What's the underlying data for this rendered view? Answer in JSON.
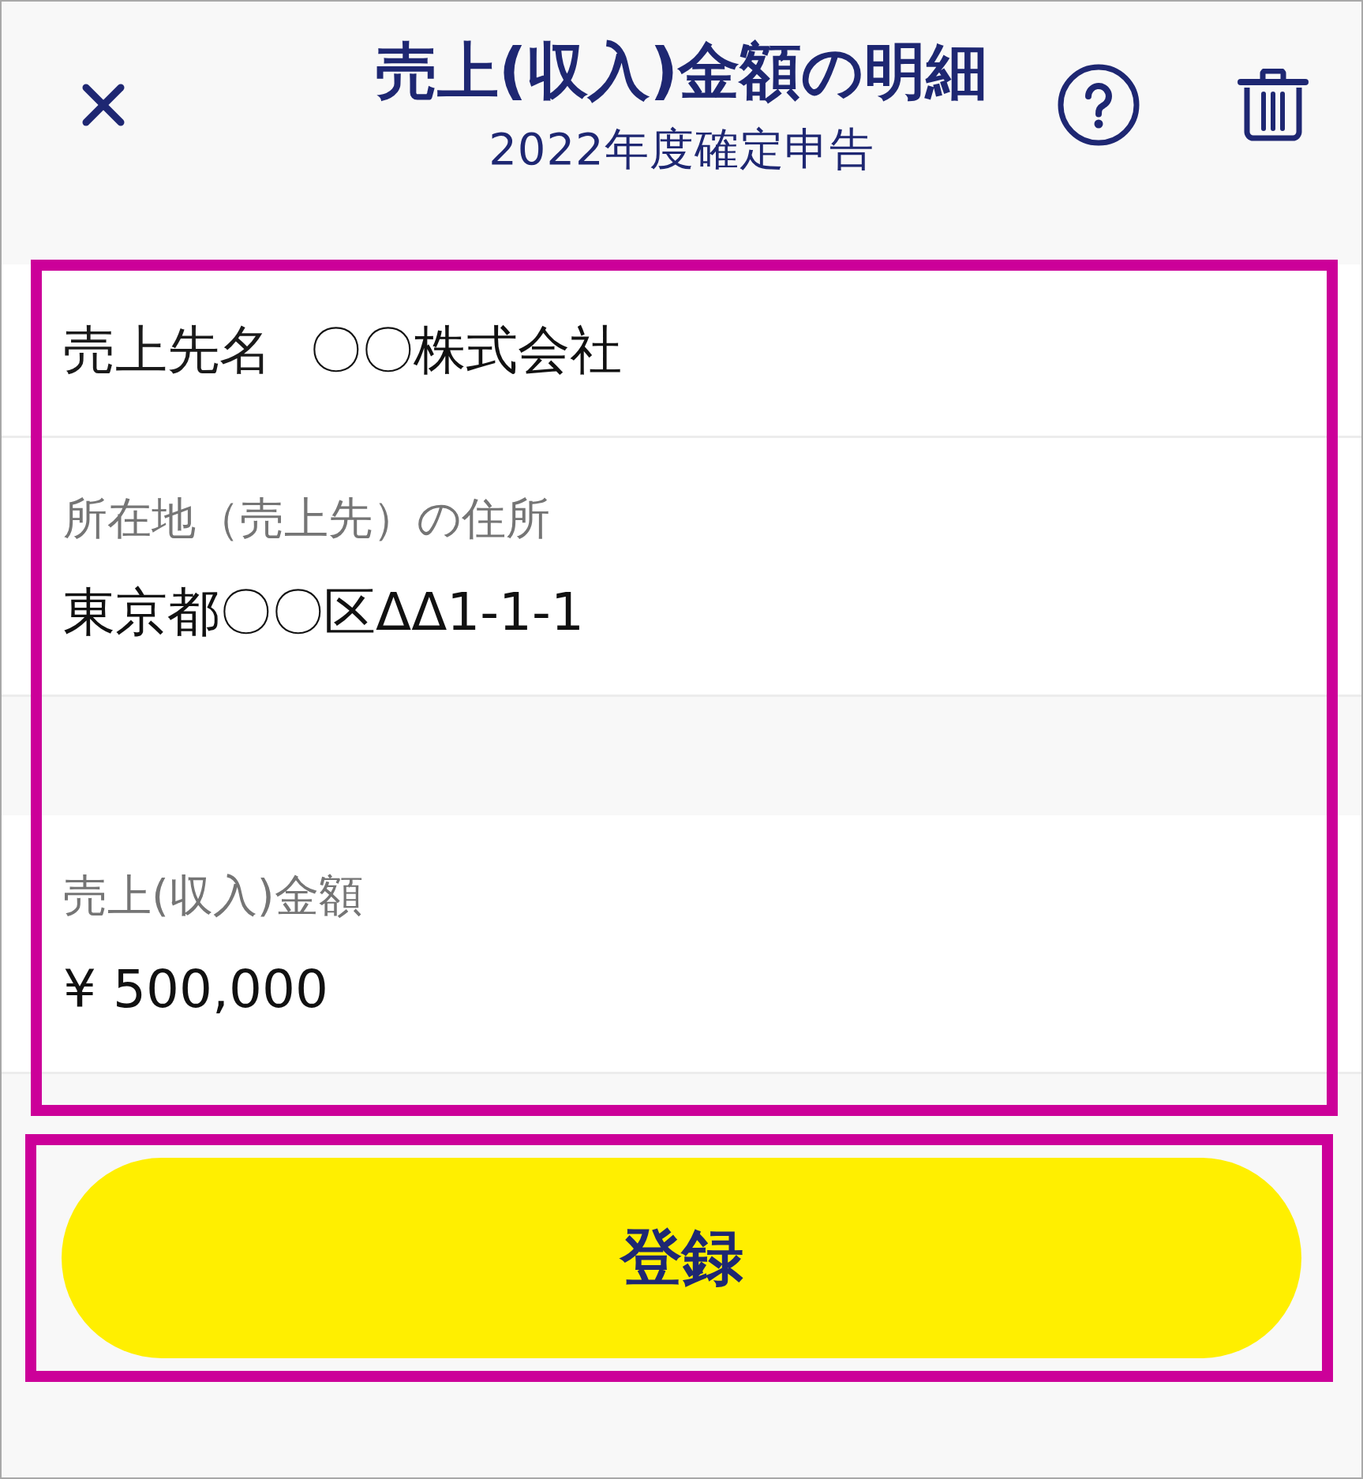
{
  "header": {
    "title": "売上(収入)金額の明細",
    "subtitle": "2022年度確定申告"
  },
  "sections": [
    {
      "fields": [
        {
          "kind": "inline",
          "label": "売上先名",
          "value": "〇〇株式会社"
        },
        {
          "kind": "stacked",
          "label": "所在地（売上先）の住所",
          "value": "東京都〇〇区ΔΔ1-1-1"
        }
      ]
    },
    {
      "fields": [
        {
          "kind": "stacked",
          "label": "売上(収入)金額",
          "value": "¥ 500,000"
        }
      ]
    }
  ],
  "submit_button": {
    "label": "登録"
  }
}
